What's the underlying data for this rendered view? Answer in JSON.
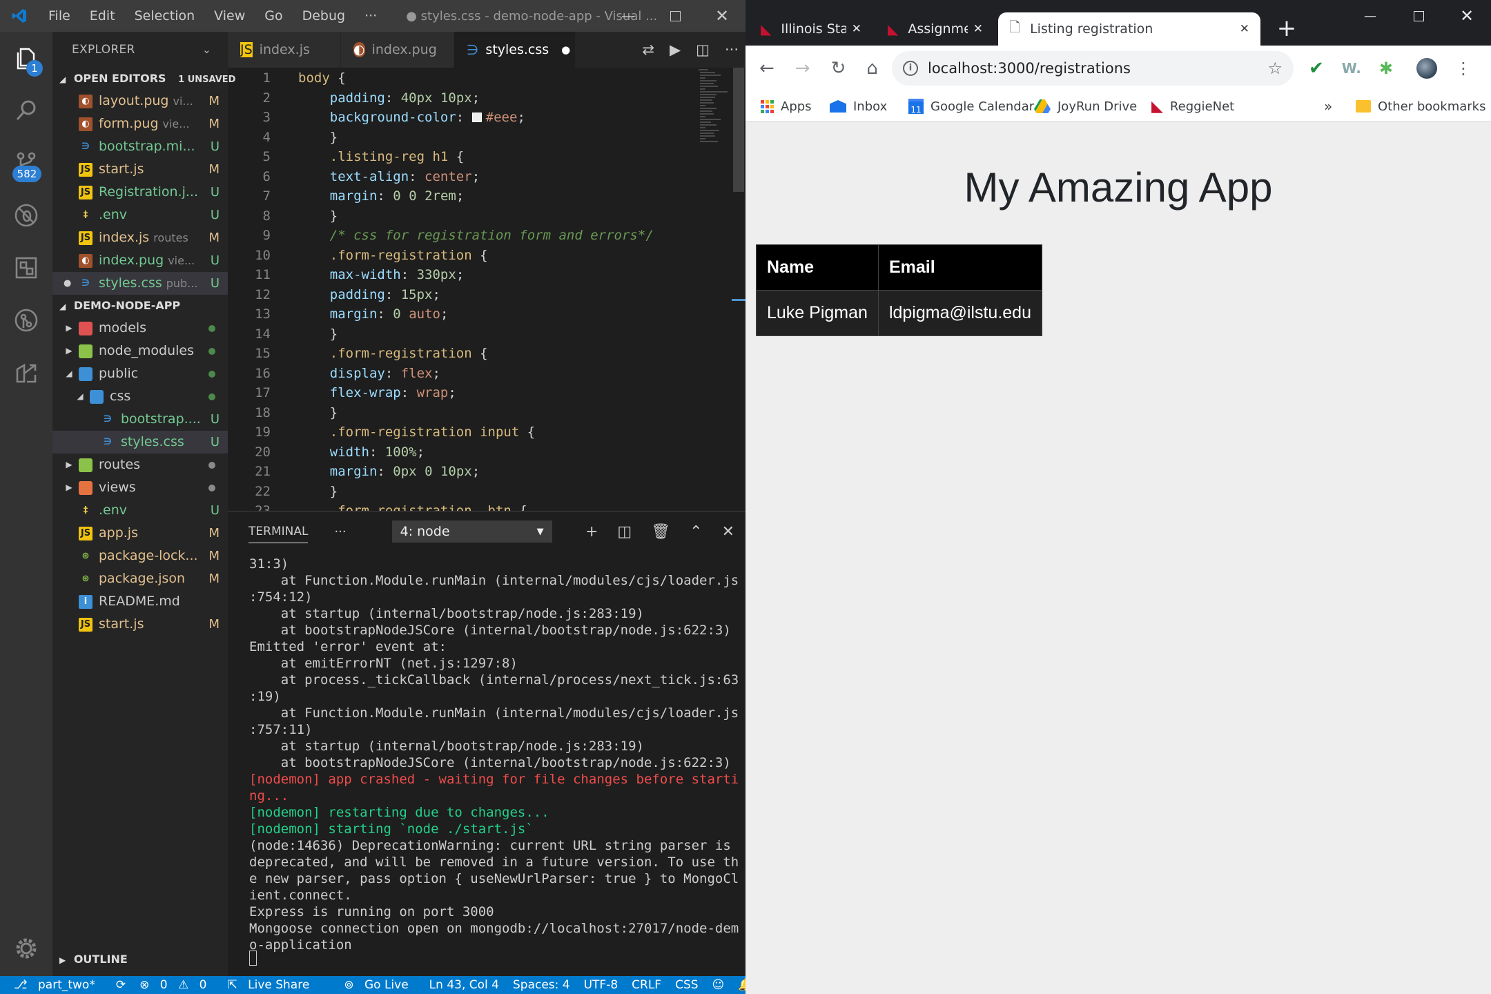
{
  "vscode": {
    "menu": [
      "File",
      "Edit",
      "Selection",
      "View",
      "Go",
      "Debug",
      "···"
    ],
    "title": "● styles.css - demo-node-app - Visual ...",
    "badges": {
      "explorer": "1",
      "scm": "582"
    },
    "explorer_label": "EXPLORER",
    "open_editors": {
      "label": "OPEN EDITORS",
      "unsaved": "1 UNSAVED",
      "items": [
        {
          "name": "layout.pug",
          "path": "vi...",
          "status": "M",
          "icon": "pug"
        },
        {
          "name": "form.pug",
          "path": "vie...",
          "status": "M",
          "icon": "pug"
        },
        {
          "name": "bootstrap.mi...",
          "path": "",
          "status": "U",
          "icon": "css"
        },
        {
          "name": "start.js",
          "path": "",
          "status": "M",
          "icon": "js"
        },
        {
          "name": "Registration.j...",
          "path": "",
          "status": "U",
          "icon": "js"
        },
        {
          "name": ".env",
          "path": "",
          "status": "U",
          "icon": "env"
        },
        {
          "name": "index.js",
          "path": "routes",
          "status": "M",
          "icon": "js"
        },
        {
          "name": "index.pug",
          "path": "vie...",
          "status": "U",
          "icon": "pug"
        },
        {
          "name": "styles.css",
          "path": "pub...",
          "status": "U",
          "icon": "css"
        }
      ]
    },
    "project": {
      "label": "DEMO-NODE-APP",
      "items": [
        {
          "name": "models",
          "type": "folder",
          "color": "#e05252",
          "status": "",
          "indent": 0,
          "twisty": "▶"
        },
        {
          "name": "node_modules",
          "type": "folder",
          "color": "#8bc34a",
          "status": "",
          "indent": 0,
          "twisty": "▶"
        },
        {
          "name": "public",
          "type": "folder",
          "color": "#3d8fd6",
          "status": "",
          "indent": 0,
          "twisty": "◢"
        },
        {
          "name": "css",
          "type": "folder",
          "color": "#3d8fd6",
          "status": "",
          "indent": 1,
          "twisty": "◢"
        },
        {
          "name": "bootstrap....",
          "type": "css",
          "status": "U",
          "indent": 2,
          "twisty": ""
        },
        {
          "name": "styles.css",
          "type": "css",
          "status": "U",
          "indent": 2,
          "twisty": ""
        },
        {
          "name": "routes",
          "type": "folder",
          "color": "#8bc34a",
          "status": "",
          "indent": 0,
          "twisty": "▶"
        },
        {
          "name": "views",
          "type": "folder",
          "color": "#e57342",
          "status": "",
          "indent": 0,
          "twisty": "▶"
        },
        {
          "name": ".env",
          "type": "env",
          "status": "U",
          "indent": 0,
          "twisty": ""
        },
        {
          "name": "app.js",
          "type": "js",
          "status": "M",
          "indent": 0,
          "twisty": ""
        },
        {
          "name": "package-lock...",
          "type": "json",
          "status": "M",
          "indent": 0,
          "twisty": ""
        },
        {
          "name": "package.json",
          "type": "json",
          "status": "M",
          "indent": 0,
          "twisty": ""
        },
        {
          "name": "README.md",
          "type": "info",
          "status": "",
          "indent": 0,
          "twisty": ""
        },
        {
          "name": "start.js",
          "type": "js",
          "status": "M",
          "indent": 0,
          "twisty": ""
        }
      ]
    },
    "outline_label": "OUTLINE",
    "tabs": [
      {
        "name": "index.js",
        "icon": "js"
      },
      {
        "name": "index.pug",
        "icon": "pug"
      },
      {
        "name": "styles.css",
        "icon": "css",
        "active": true
      }
    ],
    "code_lines": [
      [
        [
          "k",
          "body"
        ],
        [
          "t",
          " {"
        ]
      ],
      [
        [
          "p",
          "    padding"
        ],
        [
          "t",
          ": "
        ],
        [
          "n",
          "40px"
        ],
        [
          "t",
          " "
        ],
        [
          "n",
          "10px"
        ],
        [
          "t",
          ";"
        ]
      ],
      [
        [
          "p",
          "    background-color"
        ],
        [
          "t",
          ": "
        ],
        [
          "sw",
          ""
        ],
        [
          "v",
          "#eee"
        ],
        [
          "t",
          ";"
        ]
      ],
      [
        [
          "t",
          "    }"
        ]
      ],
      [
        [
          "k",
          "    .listing-reg h1"
        ],
        [
          "t",
          " {"
        ]
      ],
      [
        [
          "p",
          "    text-align"
        ],
        [
          "t",
          ": "
        ],
        [
          "v",
          "center"
        ],
        [
          "t",
          ";"
        ]
      ],
      [
        [
          "p",
          "    margin"
        ],
        [
          "t",
          ": "
        ],
        [
          "n",
          "0"
        ],
        [
          "t",
          " "
        ],
        [
          "n",
          "0"
        ],
        [
          "t",
          " "
        ],
        [
          "n",
          "2rem"
        ],
        [
          "t",
          ";"
        ]
      ],
      [
        [
          "t",
          "    }"
        ]
      ],
      [
        [
          "c",
          "    /* css for registration form and errors*/"
        ]
      ],
      [
        [
          "k",
          "    .form-registration"
        ],
        [
          "t",
          " {"
        ]
      ],
      [
        [
          "p",
          "    max-width"
        ],
        [
          "t",
          ": "
        ],
        [
          "n",
          "330px"
        ],
        [
          "t",
          ";"
        ]
      ],
      [
        [
          "p",
          "    padding"
        ],
        [
          "t",
          ": "
        ],
        [
          "n",
          "15px"
        ],
        [
          "t",
          ";"
        ]
      ],
      [
        [
          "p",
          "    margin"
        ],
        [
          "t",
          ": "
        ],
        [
          "n",
          "0"
        ],
        [
          "t",
          " "
        ],
        [
          "v",
          "auto"
        ],
        [
          "t",
          ";"
        ]
      ],
      [
        [
          "t",
          "    }"
        ]
      ],
      [
        [
          "k",
          "    .form-registration"
        ],
        [
          "t",
          " {"
        ]
      ],
      [
        [
          "p",
          "    display"
        ],
        [
          "t",
          ": "
        ],
        [
          "v",
          "flex"
        ],
        [
          "t",
          ";"
        ]
      ],
      [
        [
          "p",
          "    flex-wrap"
        ],
        [
          "t",
          ": "
        ],
        [
          "v",
          "wrap"
        ],
        [
          "t",
          ";"
        ]
      ],
      [
        [
          "t",
          "    }"
        ]
      ],
      [
        [
          "k",
          "    .form-registration input"
        ],
        [
          "t",
          " {"
        ]
      ],
      [
        [
          "p",
          "    width"
        ],
        [
          "t",
          ": "
        ],
        [
          "n",
          "100%"
        ],
        [
          "t",
          ";"
        ]
      ],
      [
        [
          "p",
          "    margin"
        ],
        [
          "t",
          ": "
        ],
        [
          "n",
          "0px"
        ],
        [
          "t",
          " "
        ],
        [
          "n",
          "0"
        ],
        [
          "t",
          " "
        ],
        [
          "n",
          "10px"
        ],
        [
          "t",
          ";"
        ]
      ],
      [
        [
          "t",
          "    }"
        ]
      ],
      [
        [
          "k",
          "    .form-registration .btn"
        ],
        [
          "t",
          " {"
        ]
      ]
    ],
    "terminal": {
      "label": "TERMINAL",
      "dots": "···",
      "selector": "4: node",
      "lines": [
        {
          "c": "",
          "t": "31:3)"
        },
        {
          "c": "",
          "t": "    at Function.Module.runMain (internal/modules/cjs/loader.js"
        },
        {
          "c": "",
          "t": ":754:12)"
        },
        {
          "c": "",
          "t": "    at startup (internal/bootstrap/node.js:283:19)"
        },
        {
          "c": "",
          "t": "    at bootstrapNodeJSCore (internal/bootstrap/node.js:622:3)"
        },
        {
          "c": "",
          "t": "Emitted 'error' event at:"
        },
        {
          "c": "",
          "t": "    at emitErrorNT (net.js:1297:8)"
        },
        {
          "c": "",
          "t": "    at process._tickCallback (internal/process/next_tick.js:63"
        },
        {
          "c": "",
          "t": ":19)"
        },
        {
          "c": "",
          "t": "    at Function.Module.runMain (internal/modules/cjs/loader.js"
        },
        {
          "c": "",
          "t": ":757:11)"
        },
        {
          "c": "",
          "t": "    at startup (internal/bootstrap/node.js:283:19)"
        },
        {
          "c": "",
          "t": "    at bootstrapNodeJSCore (internal/bootstrap/node.js:622:3)"
        },
        {
          "c": "red",
          "t": "[nodemon] app crashed - waiting for file changes before starti"
        },
        {
          "c": "red",
          "t": "ng..."
        },
        {
          "c": "green",
          "t": "[nodemon] restarting due to changes..."
        },
        {
          "c": "green",
          "t": "[nodemon] starting `node ./start.js`"
        },
        {
          "c": "",
          "t": "(node:14636) DeprecationWarning: current URL string parser is"
        },
        {
          "c": "",
          "t": "deprecated, and will be removed in a future version. To use th"
        },
        {
          "c": "",
          "t": "e new parser, pass option { useNewUrlParser: true } to MongoCl"
        },
        {
          "c": "",
          "t": "ient.connect."
        },
        {
          "c": "",
          "t": "Express is running on port 3000"
        },
        {
          "c": "",
          "t": "Mongoose connection open on mongodb://localhost:27017/node-dem"
        },
        {
          "c": "",
          "t": "o-application"
        }
      ]
    },
    "status": {
      "branch": "part_two*",
      "errors": "0",
      "warnings": "0",
      "live_share": "Live Share",
      "go_live": "Go Live",
      "position": "Ln 43, Col 4",
      "spaces": "Spaces: 4",
      "encoding": "UTF-8",
      "eol": "CRLF",
      "language": "CSS"
    }
  },
  "chrome": {
    "tabs": [
      {
        "title": "Illinois State Univer"
      },
      {
        "title": "Assignment04_Tut"
      },
      {
        "title": "Listing registration",
        "active": true
      }
    ],
    "url": "localhost:3000/registrations",
    "bookmarks": [
      "Apps",
      "Inbox",
      "Google Calendar",
      "JoyRun Drive",
      "ReggieNet"
    ],
    "more_bookmarks": "»",
    "other_bookmarks": "Other bookmarks",
    "page": {
      "title": "My Amazing App",
      "headers": [
        "Name",
        "Email"
      ],
      "rows": [
        [
          "Luke Pigman",
          "ldpigma@ilstu.edu"
        ]
      ]
    }
  }
}
